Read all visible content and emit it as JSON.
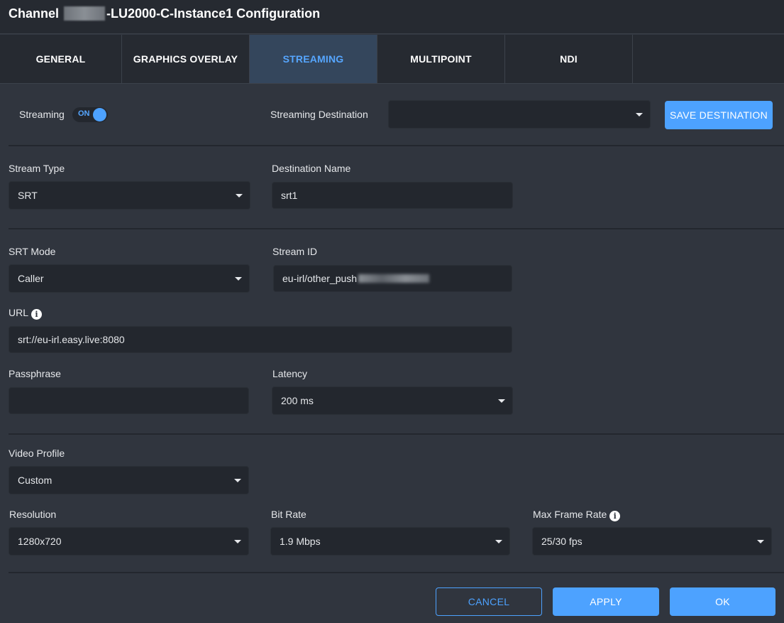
{
  "window": {
    "title_prefix": "Channel",
    "title_suffix": "-LU2000-C-Instance1 Configuration"
  },
  "tabs": [
    {
      "label": "GENERAL",
      "active": false
    },
    {
      "label": "GRAPHICS OVERLAY",
      "active": false
    },
    {
      "label": "STREAMING",
      "active": true
    },
    {
      "label": "MULTIPOINT",
      "active": false
    },
    {
      "label": "NDI",
      "active": false
    }
  ],
  "streaming": {
    "label": "Streaming",
    "toggle_label": "ON",
    "destination_label": "Streaming Destination",
    "destination_value": "",
    "save_destination_label": "SAVE DESTINATION"
  },
  "stream_type": {
    "label": "Stream Type",
    "value": "SRT"
  },
  "destination_name": {
    "label": "Destination Name",
    "value": "srt1"
  },
  "srt_mode": {
    "label": "SRT Mode",
    "value": "Caller"
  },
  "stream_id": {
    "label": "Stream ID",
    "value": "eu-irl/other_push"
  },
  "url": {
    "label": "URL",
    "value": "srt://eu-irl.easy.live:8080"
  },
  "passphrase": {
    "label": "Passphrase",
    "value": ""
  },
  "latency": {
    "label": "Latency",
    "value": "200 ms"
  },
  "video_profile": {
    "label": "Video Profile",
    "value": "Custom"
  },
  "resolution": {
    "label": "Resolution",
    "value": "1280x720"
  },
  "bit_rate": {
    "label": "Bit Rate",
    "value": "1.9 Mbps"
  },
  "max_frame_rate": {
    "label": "Max Frame Rate",
    "value": "25/30 fps"
  },
  "footer": {
    "cancel_label": "CANCEL",
    "apply_label": "APPLY",
    "ok_label": "OK"
  },
  "icons": {
    "info": "info-icon",
    "dropdown": "chevron-down-icon"
  },
  "colors": {
    "accent": "#4da2ff",
    "background": "#30353e",
    "field": "#23272e",
    "header": "#262a31"
  }
}
